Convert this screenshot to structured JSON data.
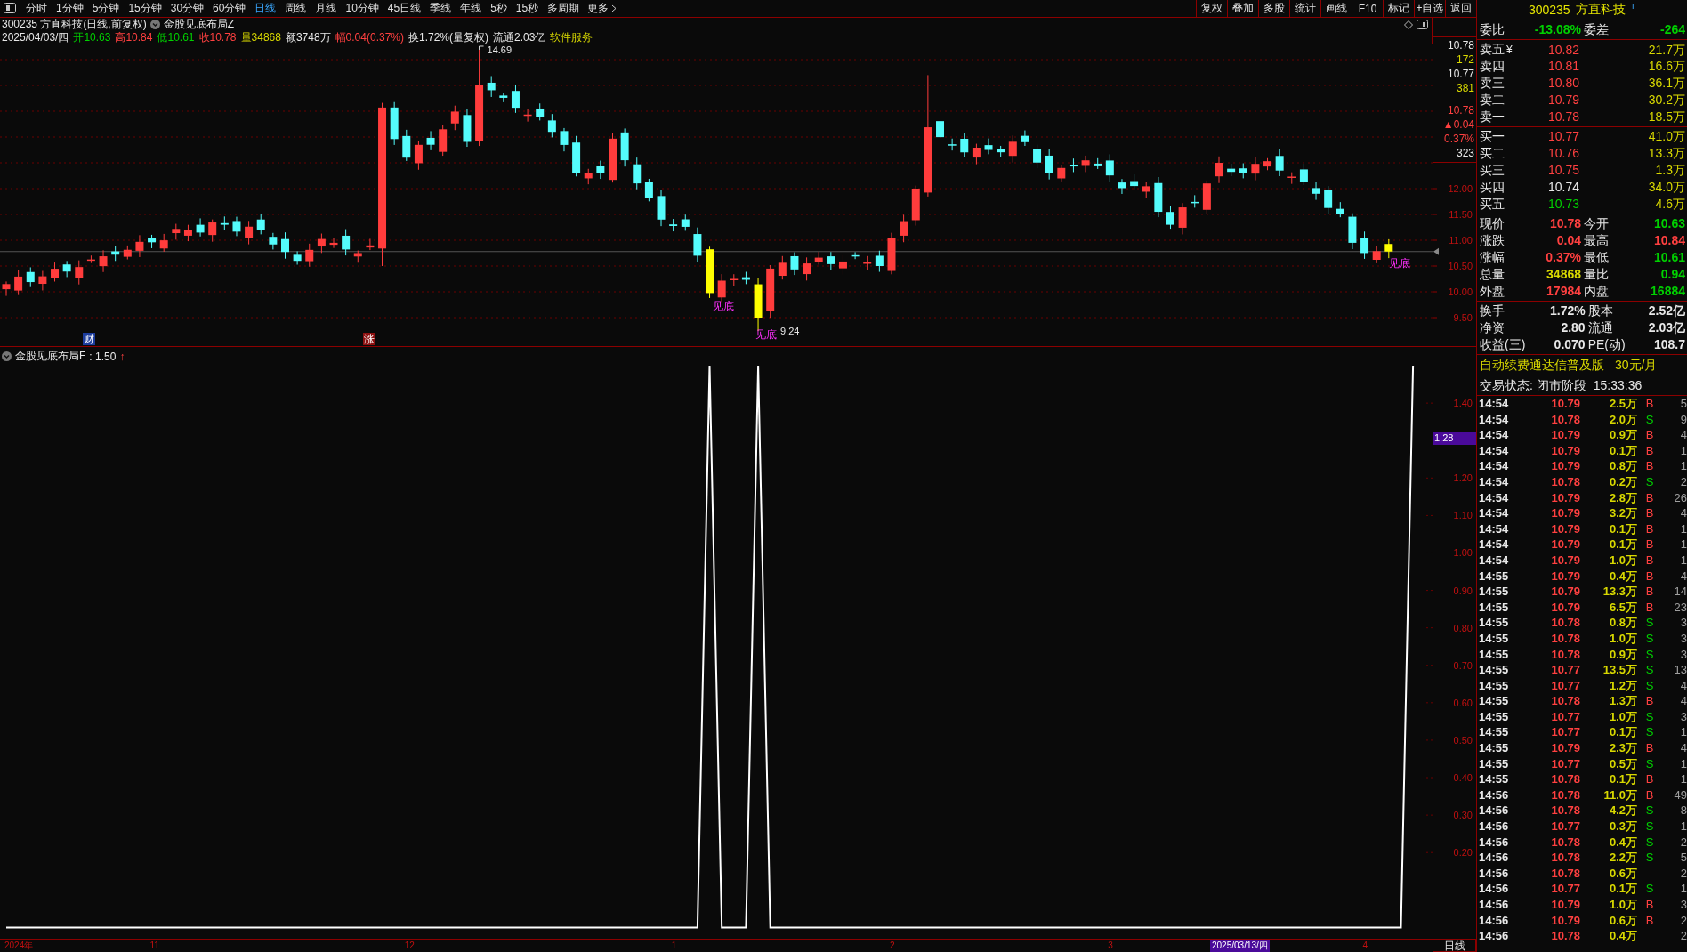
{
  "toolbar": {
    "tabs": [
      {
        "label": "分时",
        "selected": false
      },
      {
        "label": "1分钟",
        "selected": false
      },
      {
        "label": "5分钟",
        "selected": false
      },
      {
        "label": "15分钟",
        "selected": false
      },
      {
        "label": "30分钟",
        "selected": false
      },
      {
        "label": "60分钟",
        "selected": false
      },
      {
        "label": "日线",
        "selected": true
      },
      {
        "label": "周线",
        "selected": false
      },
      {
        "label": "月线",
        "selected": false
      },
      {
        "label": "10分钟",
        "selected": false
      },
      {
        "label": "45日线",
        "selected": false
      },
      {
        "label": "季线",
        "selected": false
      },
      {
        "label": "年线",
        "selected": false
      },
      {
        "label": "5秒",
        "selected": false
      },
      {
        "label": "15秒",
        "selected": false
      },
      {
        "label": "多周期",
        "selected": false
      }
    ],
    "more": "更多",
    "buttons": [
      "复权",
      "叠加",
      "多股",
      "统计",
      "画线",
      "F10",
      "标记",
      "+自选",
      "返回"
    ]
  },
  "chart": {
    "title": "300235 方直科技(日线,前复权)",
    "indicator": "金股见底布局Z",
    "quote_line": [
      {
        "text": "2025/04/03/四",
        "color": "#e8e8e8"
      },
      {
        "text": "开10.63",
        "color": "#00d000"
      },
      {
        "text": "高10.84",
        "color": "#ff4040"
      },
      {
        "text": "低10.61",
        "color": "#00d000"
      },
      {
        "text": "收10.78",
        "color": "#ff4040"
      },
      {
        "text": "量34868",
        "color": "#d8d800"
      },
      {
        "text": "额3748万",
        "color": "#e8e8e8"
      },
      {
        "text": "幅0.04(0.37%)",
        "color": "#ff4040"
      },
      {
        "text": "换1.72%(量复权)",
        "color": "#e8e8e8"
      },
      {
        "text": "流通2.03亿",
        "color": "#e8e8e8"
      }
    ],
    "sector": "软件服务",
    "high_label": "14.69",
    "low_label": "9.24",
    "signals": [
      "见底",
      "见底",
      "见底"
    ],
    "events": [
      {
        "text": "财",
        "color": "#1c3c9c"
      },
      {
        "text": "涨",
        "color": "#8c1010"
      }
    ],
    "price_axis": [
      "12.00",
      "11.50",
      "11.00",
      "10.50",
      "10.00",
      "9.50"
    ],
    "cursor_info": [
      {
        "text": "10.78",
        "color": "#e8e8e8"
      },
      {
        "text": "172",
        "color": "#d8d800"
      },
      {
        "text": "10.77",
        "color": "#e8e8e8"
      },
      {
        "text": "381",
        "color": "#d8d800"
      },
      {
        "text": "10.78",
        "color": "#ff4040"
      },
      {
        "text": "▲0.04",
        "color": "#ff4040"
      },
      {
        "text": "0.37%",
        "color": "#ff4040"
      },
      {
        "text": "323",
        "color": "#e8e8e8"
      }
    ]
  },
  "indicator": {
    "reading": ": 1.50",
    "arrow": "↑",
    "current_value": "1.28",
    "chart_data": {
      "type": "line",
      "series": [
        {
          "name": "金股见底布局F",
          "color": "#ffffff",
          "values": [
            0,
            0,
            0,
            0,
            0,
            0,
            0,
            0,
            0,
            0,
            0,
            0,
            0,
            0,
            0,
            0,
            0,
            0,
            0,
            0,
            0,
            0,
            0,
            0,
            0,
            0,
            0,
            0,
            0,
            0,
            0,
            0,
            0,
            0,
            0,
            0,
            0,
            0,
            0,
            0,
            0,
            0,
            0,
            0,
            0,
            0,
            0,
            0,
            0,
            0,
            0,
            0,
            0,
            0,
            0,
            0,
            0,
            0,
            1.5,
            0,
            0,
            0,
            1.5,
            0,
            0,
            0,
            0,
            0,
            0,
            0,
            0,
            0,
            0,
            0,
            0,
            0,
            0,
            0,
            0,
            0,
            0,
            0,
            0,
            0,
            0,
            0,
            0,
            0,
            0,
            0,
            0,
            0,
            0,
            0,
            0,
            0,
            0,
            0,
            0,
            0,
            0,
            0,
            0,
            0,
            0,
            0,
            0,
            0,
            0,
            0,
            0,
            0,
            0,
            0,
            0,
            0,
            1.5
          ]
        }
      ],
      "ylim": [
        -0.03,
        1.55
      ],
      "yticks": [
        {
          "value": 1.4,
          "label": "1.40"
        },
        {
          "value": 1.2,
          "label": "1.20"
        },
        {
          "value": 1.1,
          "label": "1.10"
        },
        {
          "value": 1.0,
          "label": "1.00"
        },
        {
          "value": 0.9,
          "label": "0.90"
        },
        {
          "value": 0.8,
          "label": "0.80"
        },
        {
          "value": 0.7,
          "label": "0.70"
        },
        {
          "value": 0.6,
          "label": "0.60"
        },
        {
          "value": 0.5,
          "label": "0.50"
        },
        {
          "value": 0.4,
          "label": "0.40"
        },
        {
          "value": 0.3,
          "label": "0.30"
        },
        {
          "value": 0.2,
          "label": "0.20"
        }
      ]
    }
  },
  "time_axis": {
    "labels": [
      "2024年",
      "11",
      "12",
      "1",
      "2",
      "3",
      "4"
    ],
    "cursor_date": "2025/03/13/四",
    "period": "日线"
  },
  "quote": {
    "code": "300235",
    "name": "方直科技",
    "badge": "T",
    "bid_ratio": [
      {
        "label": "委比",
        "value": "-13.08%"
      },
      {
        "label": "委差",
        "value": "-264"
      }
    ],
    "asks": [
      {
        "label": "卖五",
        "currency": "¥",
        "price": "10.82",
        "color": "#ff4040",
        "volume": "21.7万"
      },
      {
        "label": "卖四",
        "price": "10.81",
        "color": "#ff4040",
        "volume": "16.6万"
      },
      {
        "label": "卖三",
        "price": "10.80",
        "color": "#ff4040",
        "volume": "36.1万"
      },
      {
        "label": "卖二",
        "price": "10.79",
        "color": "#ff4040",
        "volume": "30.2万"
      },
      {
        "label": "卖一",
        "price": "10.78",
        "color": "#ff4040",
        "volume": "18.5万"
      }
    ],
    "bids": [
      {
        "label": "买一",
        "price": "10.77",
        "color": "#ff4040",
        "volume": "41.0万"
      },
      {
        "label": "买二",
        "price": "10.76",
        "color": "#ff4040",
        "volume": "13.3万"
      },
      {
        "label": "买三",
        "price": "10.75",
        "color": "#ff4040",
        "volume": "1.3万"
      },
      {
        "label": "买四",
        "price": "10.74",
        "color": "#e8e8e8",
        "volume": "34.0万"
      },
      {
        "label": "买五",
        "price": "10.73",
        "color": "#00d000",
        "volume": "4.6万"
      }
    ],
    "stats": [
      {
        "label": "现价",
        "value": "10.78",
        "color": "#ff4040"
      },
      {
        "label": "今开",
        "value": "10.63",
        "color": "#00d000"
      },
      {
        "label": "涨跌",
        "value": "0.04",
        "color": "#ff4040"
      },
      {
        "label": "最高",
        "value": "10.84",
        "color": "#ff4040"
      },
      {
        "label": "涨幅",
        "value": "0.37%",
        "color": "#ff4040"
      },
      {
        "label": "最低",
        "value": "10.61",
        "color": "#00d000"
      },
      {
        "label": "总量",
        "value": "34868",
        "color": "#d8d800"
      },
      {
        "label": "量比",
        "value": "0.94",
        "color": "#00d000"
      },
      {
        "label": "外盘",
        "value": "17984",
        "color": "#ff4040"
      },
      {
        "label": "内盘",
        "value": "16884",
        "color": "#00d000"
      }
    ],
    "fundamentals": [
      {
        "label": "换手",
        "value": "1.72%"
      },
      {
        "label": "股本",
        "value": "2.52亿"
      },
      {
        "label": "净资",
        "value": "2.80"
      },
      {
        "label": "流通",
        "value": "2.03亿"
      },
      {
        "label": "收益(三)",
        "value": "0.070"
      },
      {
        "label": "PE(动)",
        "value": "108.7"
      }
    ],
    "promo": {
      "text": "自动续费通达信普及版",
      "price": "30元/月"
    },
    "status": {
      "text": "交易状态: 闭市阶段",
      "time": "15:33:36"
    }
  },
  "trades": [
    {
      "time": "14:54",
      "price": "10.79",
      "volume": "2.5万",
      "side": "B",
      "kind": "buy",
      "count": "5"
    },
    {
      "time": "14:54",
      "price": "10.78",
      "volume": "2.0万",
      "side": "S",
      "kind": "sell",
      "count": "9"
    },
    {
      "time": "14:54",
      "price": "10.79",
      "volume": "0.9万",
      "side": "B",
      "kind": "buy",
      "count": "4"
    },
    {
      "time": "14:54",
      "price": "10.79",
      "volume": "0.1万",
      "side": "B",
      "kind": "buy",
      "count": "1"
    },
    {
      "time": "14:54",
      "price": "10.79",
      "volume": "0.8万",
      "side": "B",
      "kind": "buy",
      "count": "1"
    },
    {
      "time": "14:54",
      "price": "10.78",
      "volume": "0.2万",
      "side": "S",
      "kind": "sell",
      "count": "2"
    },
    {
      "time": "14:54",
      "price": "10.79",
      "volume": "2.8万",
      "side": "B",
      "kind": "buy",
      "count": "26"
    },
    {
      "time": "14:54",
      "price": "10.79",
      "volume": "3.2万",
      "side": "B",
      "kind": "buy",
      "count": "4"
    },
    {
      "time": "14:54",
      "price": "10.79",
      "volume": "0.1万",
      "side": "B",
      "kind": "buy",
      "count": "1"
    },
    {
      "time": "14:54",
      "price": "10.79",
      "volume": "0.1万",
      "side": "B",
      "kind": "buy",
      "count": "1"
    },
    {
      "time": "14:54",
      "price": "10.79",
      "volume": "1.0万",
      "side": "B",
      "kind": "buy",
      "count": "1"
    },
    {
      "time": "14:55",
      "price": "10.79",
      "volume": "0.4万",
      "side": "B",
      "kind": "buy",
      "count": "4"
    },
    {
      "time": "14:55",
      "price": "10.79",
      "volume": "13.3万",
      "side": "B",
      "kind": "buy",
      "count": "14"
    },
    {
      "time": "14:55",
      "price": "10.79",
      "volume": "6.5万",
      "side": "B",
      "kind": "buy",
      "count": "23"
    },
    {
      "time": "14:55",
      "price": "10.78",
      "volume": "0.8万",
      "side": "S",
      "kind": "sell",
      "count": "3"
    },
    {
      "time": "14:55",
      "price": "10.78",
      "volume": "1.0万",
      "side": "S",
      "kind": "sell",
      "count": "3"
    },
    {
      "time": "14:55",
      "price": "10.78",
      "volume": "0.9万",
      "side": "S",
      "kind": "sell",
      "count": "3"
    },
    {
      "time": "14:55",
      "price": "10.77",
      "volume": "13.5万",
      "side": "S",
      "kind": "sell",
      "count": "13"
    },
    {
      "time": "14:55",
      "price": "10.77",
      "volume": "1.2万",
      "side": "S",
      "kind": "sell",
      "count": "4"
    },
    {
      "time": "14:55",
      "price": "10.78",
      "volume": "1.3万",
      "side": "B",
      "kind": "buy",
      "count": "4"
    },
    {
      "time": "14:55",
      "price": "10.77",
      "volume": "1.0万",
      "side": "S",
      "kind": "sell",
      "count": "3"
    },
    {
      "time": "14:55",
      "price": "10.77",
      "volume": "0.1万",
      "side": "S",
      "kind": "sell",
      "count": "1"
    },
    {
      "time": "14:55",
      "price": "10.79",
      "volume": "2.3万",
      "side": "B",
      "kind": "buy",
      "count": "4"
    },
    {
      "time": "14:55",
      "price": "10.77",
      "volume": "0.5万",
      "side": "S",
      "kind": "sell",
      "count": "1"
    },
    {
      "time": "14:55",
      "price": "10.78",
      "volume": "0.1万",
      "side": "B",
      "kind": "buy",
      "count": "1"
    },
    {
      "time": "14:56",
      "price": "10.78",
      "volume": "11.0万",
      "side": "B",
      "kind": "buy",
      "count": "49"
    },
    {
      "time": "14:56",
      "price": "10.78",
      "volume": "4.2万",
      "side": "S",
      "kind": "sell",
      "count": "8"
    },
    {
      "time": "14:56",
      "price": "10.77",
      "volume": "0.3万",
      "side": "S",
      "kind": "sell",
      "count": "1"
    },
    {
      "time": "14:56",
      "price": "10.78",
      "volume": "0.4万",
      "side": "S",
      "kind": "sell",
      "count": "2"
    },
    {
      "time": "14:56",
      "price": "10.78",
      "volume": "2.2万",
      "side": "S",
      "kind": "sell",
      "count": "5"
    },
    {
      "time": "14:56",
      "price": "10.78",
      "volume": "0.6万",
      "count": "2"
    },
    {
      "time": "14:56",
      "price": "10.77",
      "volume": "0.1万",
      "side": "S",
      "kind": "sell",
      "count": "1"
    },
    {
      "time": "14:56",
      "price": "10.79",
      "volume": "1.0万",
      "side": "B",
      "kind": "buy",
      "count": "3"
    },
    {
      "time": "14:56",
      "price": "10.79",
      "volume": "0.6万",
      "side": "B",
      "kind": "buy",
      "count": "2"
    },
    {
      "time": "14:56",
      "price": "10.78",
      "volume": "0.4万",
      "count": "2"
    }
  ]
}
